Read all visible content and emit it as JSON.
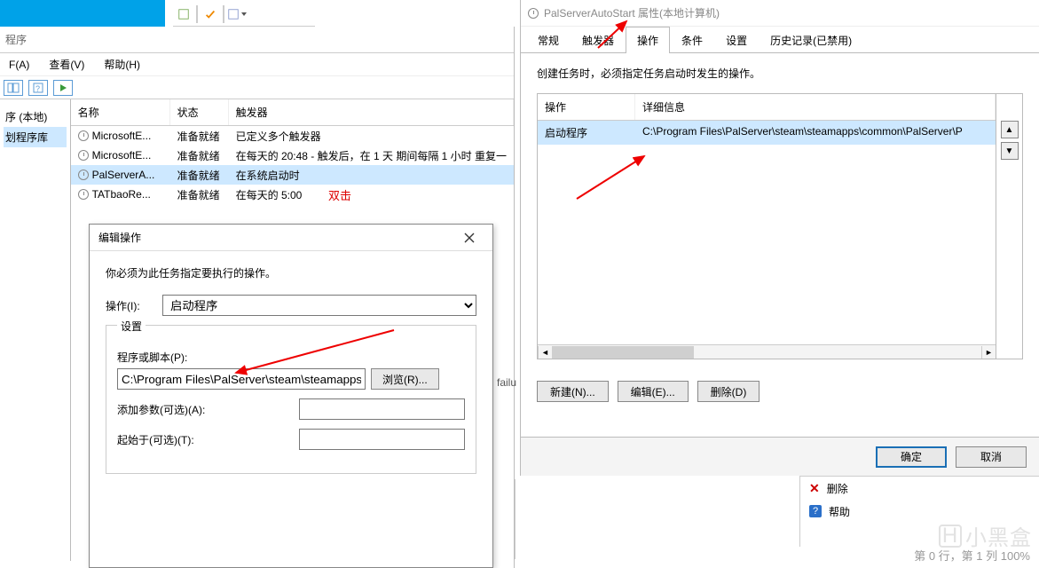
{
  "toolbar_top": {
    "label": "程序"
  },
  "menu": {
    "file": "F(A)",
    "view": "查看(V)",
    "help": "帮助(H)"
  },
  "tree": {
    "root": "序 (本地)",
    "lib": "划程序库"
  },
  "list": {
    "headers": {
      "name": "名称",
      "status": "状态",
      "trigger": "触发器"
    },
    "rows": [
      {
        "name": "MicrosoftE...",
        "status": "准备就绪",
        "trigger": "已定义多个触发器"
      },
      {
        "name": "MicrosoftE...",
        "status": "准备就绪",
        "trigger": "在每天的 20:48 - 触发后，在 1 天 期间每隔 1 小时 重复一"
      },
      {
        "name": "PalServerA...",
        "status": "准备就绪",
        "trigger": "在系统启动时"
      },
      {
        "name": "TATbaoRe...",
        "status": "准备就绪",
        "trigger": "在每天的 5:00"
      }
    ]
  },
  "dblclick": "双击",
  "edit_dialog": {
    "title": "编辑操作",
    "instruction": "你必须为此任务指定要执行的操作。",
    "action_label": "操作(I):",
    "action_value": "启动程序",
    "settings_legend": "设置",
    "program_label": "程序或脚本(P):",
    "program_value": "C:\\Program Files\\PalServer\\steam\\steamapps\\comm",
    "browse": "浏览(R)...",
    "args_label": "添加参数(可选)(A):",
    "args_value": "",
    "startin_label": "起始于(可选)(T):",
    "startin_value": ""
  },
  "props_dialog": {
    "title": "PalServerAutoStart 属性(本地计算机)",
    "tabs": {
      "general": "常规",
      "triggers": "触发器",
      "actions": "操作",
      "conditions": "条件",
      "settings": "设置",
      "history": "历史记录(已禁用)"
    },
    "hint": "创建任务时，必须指定任务启动时发生的操作。",
    "cols": {
      "op": "操作",
      "detail": "详细信息"
    },
    "row": {
      "op": "启动程序",
      "detail": "C:\\Program Files\\PalServer\\steam\\steamapps\\common\\PalServer\\P"
    },
    "new": "新建(N)...",
    "edit": "编辑(E)...",
    "delete": "删除(D)",
    "ok": "确定",
    "cancel": "取消"
  },
  "rpane": {
    "delete": "删除",
    "help": "帮助"
  },
  "failu": "failu",
  "statusbar": "第 0 行，第 1 列        100%",
  "watermark": "小黑盒"
}
